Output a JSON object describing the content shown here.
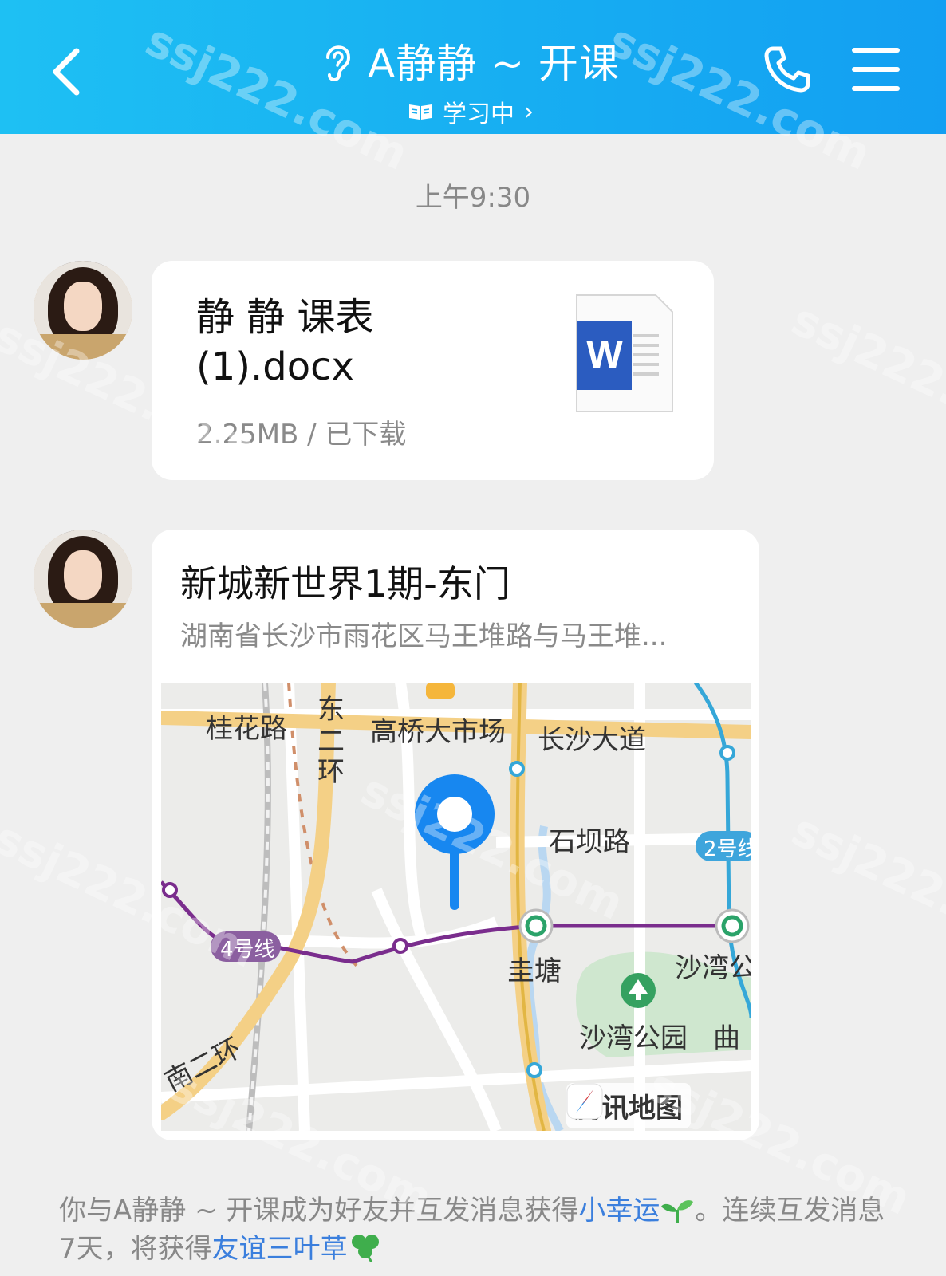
{
  "header": {
    "title": "A静静 ~ 开课",
    "status": "学习中",
    "status_arrow": "›"
  },
  "timestamp": "上午9:30",
  "file_message": {
    "name_line1": "静 静 课表",
    "name_line2": "(1).docx",
    "meta": "2.25MB / 已下载",
    "icon_letter": "W"
  },
  "location_message": {
    "name": "新城新世界1期-东门",
    "address": "湖南省长沙市雨花区马王堆路与马王堆...",
    "map": {
      "labels": {
        "guihua": "桂花路",
        "dong": "东",
        "er": "二",
        "huan": "环",
        "gaoqiao": "高桥大市场",
        "changsha": "长沙大道",
        "shiba": "石坝路",
        "line2": "2号线",
        "line4": "4号线",
        "guitang": "圭塘",
        "shawan": "沙湾公",
        "shawan_park": "沙湾公园",
        "qu": "曲",
        "nan_erhuan": "南二环"
      },
      "brand": "腾讯地图"
    }
  },
  "notice": {
    "prefix": "你与A静静 ~ 开课成为好友并互发消息获得",
    "link1": "小幸运",
    "middle": "。连续互发消息7天，将获得",
    "link2": "友谊三叶草"
  },
  "watermark": "ssj222.com",
  "colors": {
    "header_start": "#1ec0f3",
    "header_end": "#139ff2",
    "link": "#3b7fdd",
    "word_blue": "#2b5cc0",
    "pin_blue": "#1787f0"
  }
}
